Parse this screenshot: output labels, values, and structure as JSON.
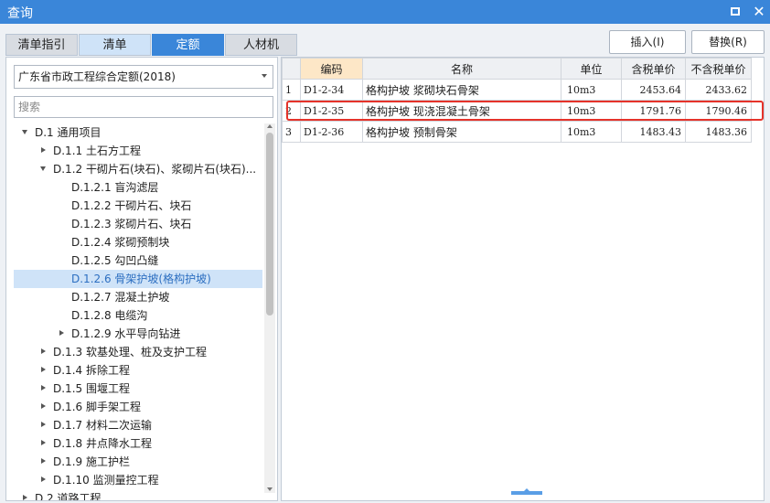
{
  "window": {
    "title": "查询"
  },
  "tabs": [
    {
      "label": "清单指引"
    },
    {
      "label": "清单"
    },
    {
      "label": "定额"
    },
    {
      "label": "人材机"
    }
  ],
  "buttons": {
    "insert": "插入(I)",
    "replace": "替换(R)"
  },
  "left": {
    "dropdown_value": "广东省市政工程综合定额(2018)",
    "search_placeholder": "搜索",
    "tree": [
      {
        "label": "D.1 通用项目",
        "expander": "down",
        "level": 0
      },
      {
        "label": "D.1.1 土石方工程",
        "expander": "right",
        "level": 1
      },
      {
        "label": "D.1.2 干砌片石(块石)、浆砌片石(块石)...",
        "expander": "down",
        "level": 1
      },
      {
        "label": "D.1.2.1 盲沟滤层",
        "expander": "none",
        "level": 2
      },
      {
        "label": "D.1.2.2 干砌片石、块石",
        "expander": "none",
        "level": 2
      },
      {
        "label": "D.1.2.3 浆砌片石、块石",
        "expander": "none",
        "level": 2
      },
      {
        "label": "D.1.2.4 浆砌预制块",
        "expander": "none",
        "level": 2
      },
      {
        "label": "D.1.2.5 勾凹凸缝",
        "expander": "none",
        "level": 2
      },
      {
        "label": "D.1.2.6 骨架护坡(格构护坡)",
        "expander": "none",
        "level": 2,
        "selected": true
      },
      {
        "label": "D.1.2.7 混凝土护坡",
        "expander": "none",
        "level": 2
      },
      {
        "label": "D.1.2.8 电缆沟",
        "expander": "none",
        "level": 2
      },
      {
        "label": "D.1.2.9 水平导向钻进",
        "expander": "right",
        "level": 2
      },
      {
        "label": "D.1.3 软基处理、桩及支护工程",
        "expander": "right",
        "level": 1
      },
      {
        "label": "D.1.4 拆除工程",
        "expander": "right",
        "level": 1
      },
      {
        "label": "D.1.5 围堰工程",
        "expander": "right",
        "level": 1
      },
      {
        "label": "D.1.6 脚手架工程",
        "expander": "right",
        "level": 1
      },
      {
        "label": "D.1.7 材料二次运输",
        "expander": "right",
        "level": 1
      },
      {
        "label": "D.1.8 井点降水工程",
        "expander": "right",
        "level": 1
      },
      {
        "label": "D.1.9 施工护栏",
        "expander": "right",
        "level": 1
      },
      {
        "label": "D.1.10 监测量控工程",
        "expander": "right",
        "level": 1
      },
      {
        "label": "D.2 道路工程",
        "expander": "right",
        "level": 0
      }
    ]
  },
  "grid": {
    "columns": [
      "编码",
      "名称",
      "单位",
      "含税单价",
      "不含税单价"
    ],
    "rows": [
      {
        "idx": "1",
        "code": "D1-2-34",
        "name": "格构护坡 浆砌块石骨架",
        "unit": "10m3",
        "price_tax": "2453.64",
        "price_notax": "2433.62"
      },
      {
        "idx": "2",
        "code": "D1-2-35",
        "name": "格构护坡 现浇混凝土骨架",
        "unit": "10m3",
        "price_tax": "1791.76",
        "price_notax": "1790.46"
      },
      {
        "idx": "3",
        "code": "D1-2-36",
        "name": "格构护坡 预制骨架",
        "unit": "10m3",
        "price_tax": "1483.43",
        "price_notax": "1483.36"
      }
    ]
  }
}
